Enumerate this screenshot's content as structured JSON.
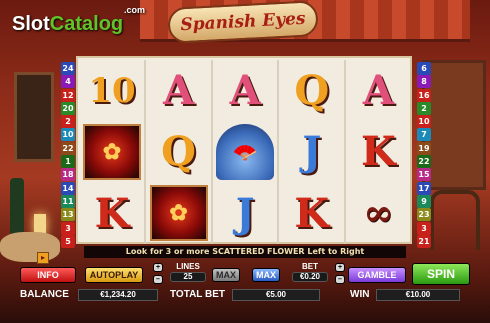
{
  "branding": {
    "logo_slot": "Slot",
    "logo_catalog": "Catalog",
    "logo_com": ".com",
    "game_title": "Spanish Eyes"
  },
  "reels": [
    [
      "10",
      "scatter",
      "K"
    ],
    [
      "A",
      "Q",
      "scatter"
    ],
    [
      "A",
      "fan",
      "J"
    ],
    [
      "Q",
      "J",
      "K"
    ],
    [
      "A",
      "K",
      "castanets"
    ]
  ],
  "symbol_glyphs": {
    "scatter": "✿",
    "fan": "🪭",
    "castanets": "∞"
  },
  "lines_left": [
    {
      "n": "24",
      "c": "#2a4ab8"
    },
    {
      "n": "4",
      "c": "#8a1ab8"
    },
    {
      "n": "12",
      "c": "#c8201a"
    },
    {
      "n": "20",
      "c": "#2a8a2a"
    },
    {
      "n": "2",
      "c": "#c8201a"
    },
    {
      "n": "10",
      "c": "#1a8ab8"
    },
    {
      "n": "22",
      "c": "#8a4a1a"
    },
    {
      "n": "1",
      "c": "#1a6a1a"
    },
    {
      "n": "18",
      "c": "#b82a8a"
    },
    {
      "n": "14",
      "c": "#2a4ab8"
    },
    {
      "n": "11",
      "c": "#1a8a5a"
    },
    {
      "n": "13",
      "c": "#8a8a1a"
    },
    {
      "n": "3",
      "c": "#c8201a"
    },
    {
      "n": "5",
      "c": "#c8201a"
    }
  ],
  "lines_right": [
    {
      "n": "6",
      "c": "#2a4ab8"
    },
    {
      "n": "8",
      "c": "#8a1ab8"
    },
    {
      "n": "16",
      "c": "#c8201a"
    },
    {
      "n": "2",
      "c": "#2a8a2a"
    },
    {
      "n": "10",
      "c": "#c8201a"
    },
    {
      "n": "7",
      "c": "#1a8ab8"
    },
    {
      "n": "19",
      "c": "#8a4a1a"
    },
    {
      "n": "22",
      "c": "#1a6a1a"
    },
    {
      "n": "15",
      "c": "#b82a8a"
    },
    {
      "n": "17",
      "c": "#2a4ab8"
    },
    {
      "n": "9",
      "c": "#1a8a5a"
    },
    {
      "n": "23",
      "c": "#8a8a1a"
    },
    {
      "n": "3",
      "c": "#c8201a"
    },
    {
      "n": "21",
      "c": "#c8201a"
    }
  ],
  "message": "Look for 3 or more SCATTERED FLOWER Left to Right",
  "controls": {
    "info": "INFO",
    "autoplay": "AUTOPLAY",
    "lines_label": "LINES",
    "lines_value": "25",
    "max_lines": "MAX",
    "max_bet": "MAX",
    "bet_label": "BET",
    "bet_value": "€0.20",
    "gamble": "GAMBLE",
    "spin": "SPIN",
    "plus": "+",
    "minus": "–",
    "corner": "▸"
  },
  "footer": {
    "balance_label": "BALANCE",
    "balance_value": "€1,234.20",
    "total_bet_label": "TOTAL BET",
    "total_bet_value": "€5.00",
    "win_label": "WIN",
    "win_value": "€10.00"
  }
}
